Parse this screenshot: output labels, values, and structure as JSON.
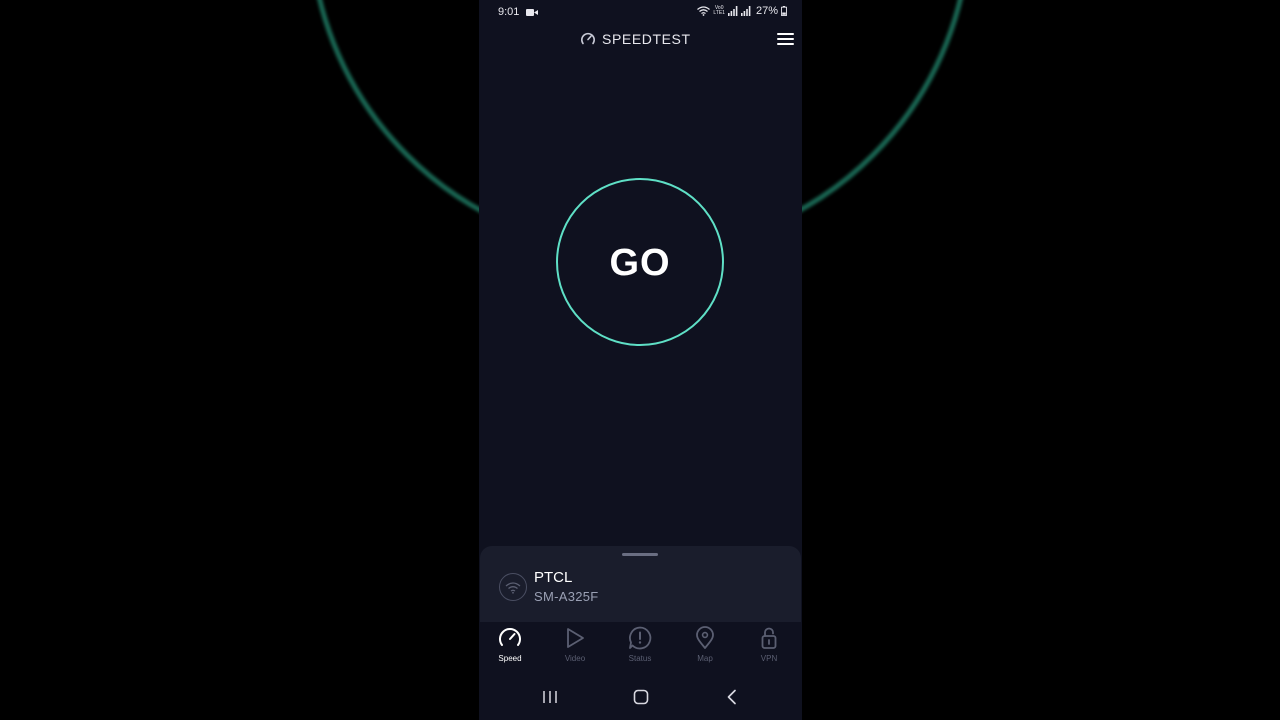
{
  "status_bar": {
    "time": "9:01",
    "volte_top": "Vo0",
    "volte_bottom": "LTE1",
    "battery": "27%"
  },
  "header": {
    "title": "SPEEDTEST",
    "logo_icon": "speedometer-icon",
    "menu_icon": "hamburger-menu-icon"
  },
  "go_button": {
    "label": "GO",
    "ring_color": "#5fe0c6"
  },
  "connection": {
    "isp": "PTCL",
    "device": "SM-A325F",
    "icon": "wifi-icon"
  },
  "nav": {
    "items": [
      {
        "label": "Speed",
        "icon": "speedometer-icon",
        "active": true
      },
      {
        "label": "Video",
        "icon": "play-icon",
        "active": false
      },
      {
        "label": "Status",
        "icon": "alert-icon",
        "active": false
      },
      {
        "label": "Map",
        "icon": "map-pin-icon",
        "active": false
      },
      {
        "label": "VPN",
        "icon": "unlock-icon",
        "active": false
      }
    ]
  },
  "colors": {
    "background": "#0f111f",
    "accent": "#5fe0c6",
    "sheet": "#1a1d2c",
    "inactive": "#5b5f72"
  }
}
